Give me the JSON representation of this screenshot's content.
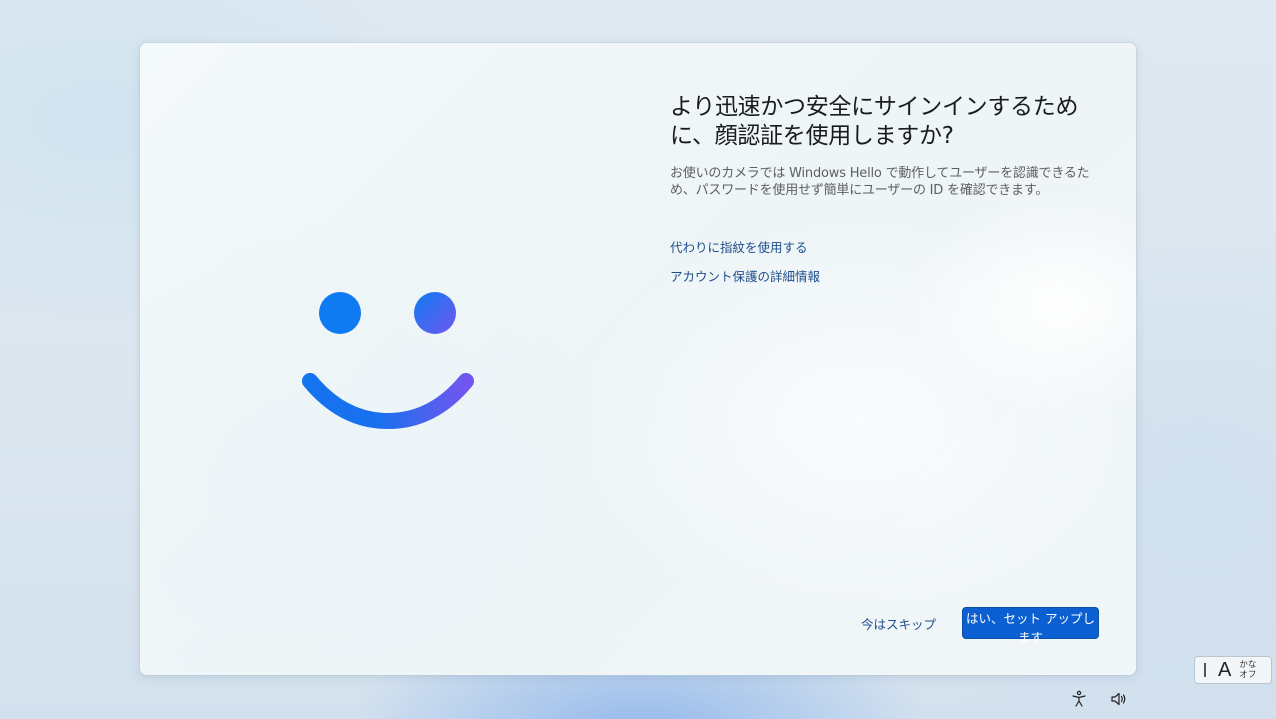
{
  "setup": {
    "title": "より迅速かつ安全にサインインするために、顔認証を使用しますか?",
    "description": "お使いのカメラでは Windows Hello で動作してユーザーを認識できるため、パスワードを使用せず簡単にユーザーの ID を確認できます。",
    "links": {
      "fingerprint": "代わりに指紋を使用する",
      "account_protection": "アカウント保護の詳細情報"
    },
    "buttons": {
      "skip": "今はスキップ",
      "setup": "はい、セット アップします"
    },
    "illustration": {
      "icon": "windows-hello-face-icon",
      "colors": {
        "blue": "#0f7bf2",
        "purple": "#6f58f0"
      }
    }
  },
  "taskbar": {
    "ime": {
      "mode": "A",
      "kana_top": "かな",
      "kana_bottom": "オフ"
    },
    "icons": [
      "accessibility-icon",
      "volume-icon"
    ]
  },
  "theme": {
    "accent": "#0b5fd0",
    "link": "#1f4e8c"
  }
}
